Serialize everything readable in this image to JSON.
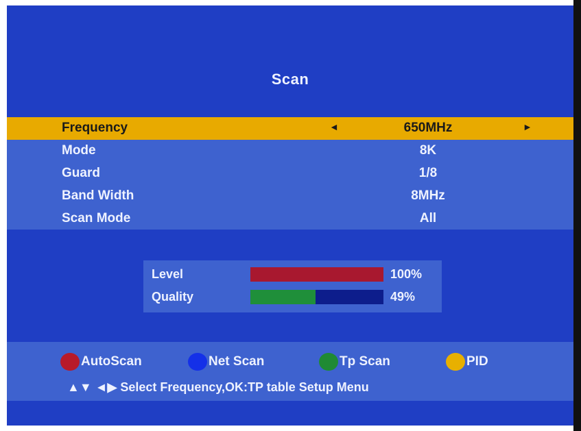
{
  "screen": {
    "title": "Scan"
  },
  "menu": {
    "rows": [
      {
        "label": "Frequency",
        "value": "650MHz",
        "selected": true
      },
      {
        "label": "Mode",
        "value": "8K"
      },
      {
        "label": "Guard",
        "value": "1/8"
      },
      {
        "label": "Band Width",
        "value": "8MHz"
      },
      {
        "label": "Scan Mode",
        "value": "All"
      }
    ],
    "arrow_left": "◄",
    "arrow_right": "►"
  },
  "signal": {
    "level": {
      "label": "Level",
      "percent_text": "100%",
      "fraction": 1.0,
      "color": "#a8182f"
    },
    "quality": {
      "label": "Quality",
      "percent_text": "49%",
      "fraction": 0.49,
      "color": "#1f8f3a"
    },
    "bar_bg_color": "#0d1d8c"
  },
  "color_keys": [
    {
      "label": "AutoScan",
      "color": "#b81a2a",
      "icon": "red-button-icon"
    },
    {
      "label": "Net Scan",
      "color": "#1430e8",
      "icon": "blue-button-icon"
    },
    {
      "label": "Tp Scan",
      "color": "#1f8a34",
      "icon": "green-button-icon"
    },
    {
      "label": "PID",
      "color": "#e8b000",
      "icon": "yellow-button-icon"
    }
  ],
  "help": {
    "nav_arrows": "▲▼ ◄▶",
    "text": "Select Frequency,OK:TP table Setup Menu"
  },
  "colors": {
    "background": "#1f3ec4",
    "panel": "#3e62cf",
    "highlight": "#e8aa00"
  }
}
